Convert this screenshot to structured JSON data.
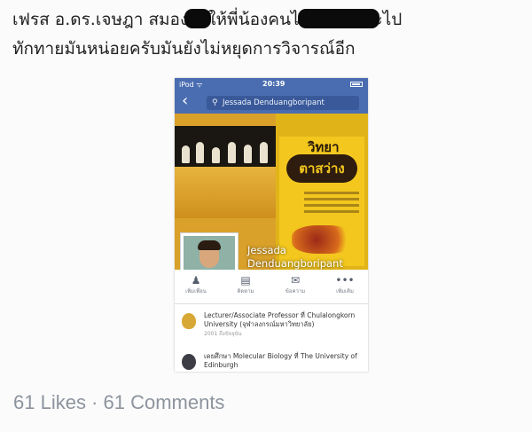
{
  "post": {
    "line1_a": "เฟรส อ.ดร.เจษฎา สมอง",
    "line1_b": "ให้พี่น้องคนไ",
    "line1_c": "ะไป",
    "line2": "ทักทายมันหน่อยครับมันยังไม่หยุดการวิจารณ์อีก",
    "likes_comments": "61 Likes · 61 Comments"
  },
  "phone": {
    "status": {
      "carrier": "iPod ᯤ",
      "time": "20:39"
    },
    "search_query": "Jessada Denduangboripant",
    "profile_name": "Jessada Denduangboripant",
    "cover_book": {
      "title_top": "วิทยา",
      "title_main": "ตาสว่าง"
    },
    "actions": [
      {
        "icon": "add-friend-icon",
        "glyph": "♟",
        "label": "เพิ่มเพื่อน"
      },
      {
        "icon": "follow-icon",
        "glyph": "▤",
        "label": "ติดตาม"
      },
      {
        "icon": "message-icon",
        "glyph": "✉",
        "label": "ข้อความ"
      },
      {
        "icon": "more-icon",
        "glyph": "•••",
        "label": "เพิ่มเติม"
      }
    ],
    "about": [
      {
        "icon": "university-crest-icon",
        "text": "Lecturer/Associate Professor ที่ Chulalongkorn University (จุฬาลงกรณ์มหาวิทยาลัย)",
        "sub": "2001 ถึงปัจจุบัน"
      },
      {
        "icon": "edinburgh-crest-icon",
        "text": "เคยศึกษา Molecular Biology ที่ The University of Edinburgh",
        "sub": ""
      }
    ]
  },
  "colors": {
    "facebook_blue": "#4a6db1",
    "cover_yellow": "#e0b419"
  }
}
